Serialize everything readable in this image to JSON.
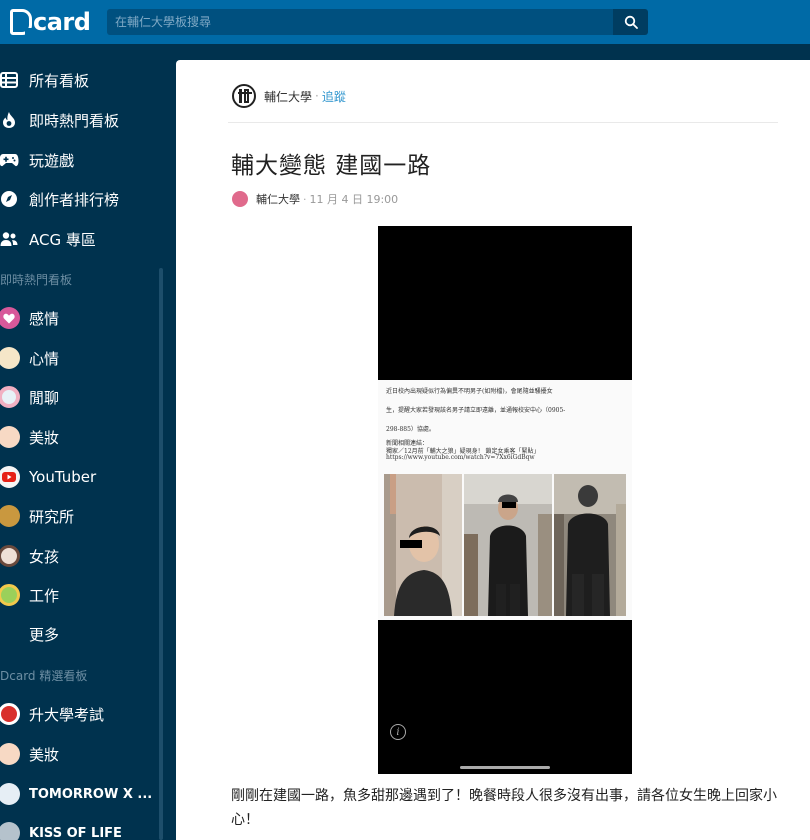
{
  "header": {
    "logo_text": "card",
    "search_placeholder": "在輔仁大學板搜尋"
  },
  "sidebar": {
    "main_items": [
      {
        "label": "所有看板",
        "icon": "board-list-icon"
      },
      {
        "label": "即時熱門看板",
        "icon": "fire-icon"
      },
      {
        "label": "玩遊戲",
        "icon": "gamepad-icon"
      },
      {
        "label": "創作者排行榜",
        "icon": "creator-ranking-icon"
      },
      {
        "label": "ACG 專區",
        "icon": "acg-users-icon"
      }
    ],
    "hot_title": "即時熱門看板",
    "hot_items": [
      {
        "label": "感情"
      },
      {
        "label": "心情"
      },
      {
        "label": "閒聊"
      },
      {
        "label": "美妝"
      },
      {
        "label": "YouTuber"
      },
      {
        "label": "研究所"
      },
      {
        "label": "女孩"
      },
      {
        "label": "工作"
      }
    ],
    "more_label": "更多",
    "featured_title": "Dcard 精選看板",
    "featured_items": [
      {
        "label": "升大學考試"
      },
      {
        "label": "美妝"
      },
      {
        "label": "TOMORROW X ..."
      },
      {
        "label": "KISS OF LIFE"
      }
    ]
  },
  "post": {
    "forum_name": "輔仁大學",
    "follow_label": "追蹤",
    "separator": "·",
    "title": "輔大變態 建國一路",
    "author": "輔仁大學",
    "time": "11 月 4 日 19:00",
    "image_text": {
      "line1": "近日校內出現疑似行為偏異不明男子(如附檔)，會尾隨並騷擾女",
      "line2": "生，提醒大家若發現該名男子請立即遠離，並通報校安中心（0905-",
      "line3": "298-885）協處。",
      "line4": "新聞相關連結：",
      "line5": "獨家／12月前「輔大之狼」疑現身！ 鎖定女乘客「緊貼」",
      "line6": "https://www.youtube.com/watch?v=7Xx6iGdBqw"
    },
    "body": "剛剛在建國一路，魚多甜那邊遇到了！晚餐時段人很多沒有出事，請各位女生晚上回家小心！"
  }
}
